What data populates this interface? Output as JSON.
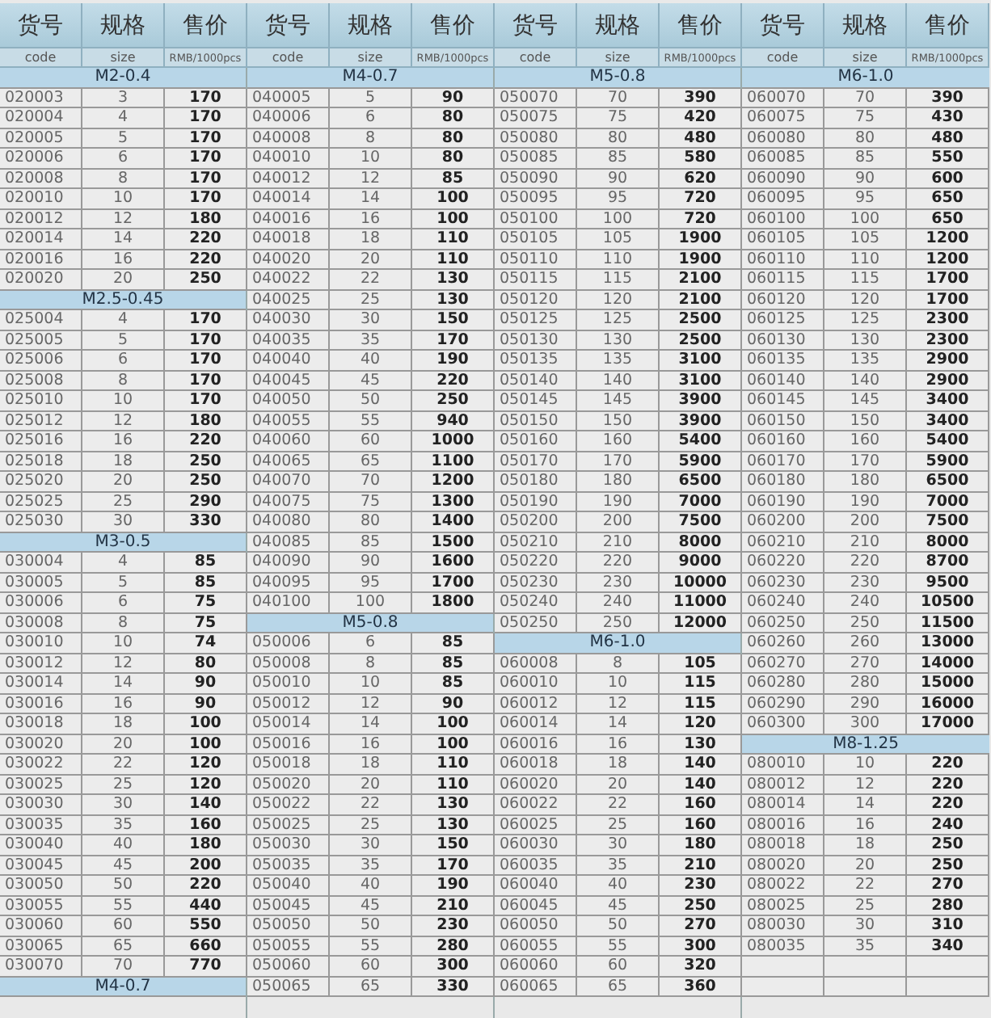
{
  "groups": [
    {
      "headers": [
        "货号",
        "规格",
        "售价"
      ],
      "subheaders": [
        "code",
        "size",
        "RMB/1000pcs"
      ],
      "entries": [
        {
          "kind": "section",
          "label": "M2-0.4"
        },
        {
          "kind": "item",
          "cells": [
            "020003",
            "3",
            "170"
          ]
        },
        {
          "kind": "item",
          "cells": [
            "020004",
            "4",
            "170"
          ]
        },
        {
          "kind": "item",
          "cells": [
            "020005",
            "5",
            "170"
          ]
        },
        {
          "kind": "item",
          "cells": [
            "020006",
            "6",
            "170"
          ]
        },
        {
          "kind": "item",
          "cells": [
            "020008",
            "8",
            "170"
          ]
        },
        {
          "kind": "item",
          "cells": [
            "020010",
            "10",
            "170"
          ]
        },
        {
          "kind": "item",
          "cells": [
            "020012",
            "12",
            "180"
          ]
        },
        {
          "kind": "item",
          "cells": [
            "020014",
            "14",
            "220"
          ]
        },
        {
          "kind": "item",
          "cells": [
            "020016",
            "16",
            "220"
          ]
        },
        {
          "kind": "item",
          "cells": [
            "020020",
            "20",
            "250"
          ]
        },
        {
          "kind": "section",
          "label": "M2.5-0.45"
        },
        {
          "kind": "item",
          "cells": [
            "025004",
            "4",
            "170"
          ]
        },
        {
          "kind": "item",
          "cells": [
            "025005",
            "5",
            "170"
          ]
        },
        {
          "kind": "item",
          "cells": [
            "025006",
            "6",
            "170"
          ]
        },
        {
          "kind": "item",
          "cells": [
            "025008",
            "8",
            "170"
          ]
        },
        {
          "kind": "item",
          "cells": [
            "025010",
            "10",
            "170"
          ]
        },
        {
          "kind": "item",
          "cells": [
            "025012",
            "12",
            "180"
          ]
        },
        {
          "kind": "item",
          "cells": [
            "025016",
            "16",
            "220"
          ]
        },
        {
          "kind": "item",
          "cells": [
            "025018",
            "18",
            "250"
          ]
        },
        {
          "kind": "item",
          "cells": [
            "025020",
            "20",
            "250"
          ]
        },
        {
          "kind": "item",
          "cells": [
            "025025",
            "25",
            "290"
          ]
        },
        {
          "kind": "item",
          "cells": [
            "025030",
            "30",
            "330"
          ]
        },
        {
          "kind": "section",
          "label": "M3-0.5"
        },
        {
          "kind": "item",
          "cells": [
            "030004",
            "4",
            "85"
          ]
        },
        {
          "kind": "item",
          "cells": [
            "030005",
            "5",
            "85"
          ]
        },
        {
          "kind": "item",
          "cells": [
            "030006",
            "6",
            "75"
          ]
        },
        {
          "kind": "item",
          "cells": [
            "030008",
            "8",
            "75"
          ]
        },
        {
          "kind": "item",
          "cells": [
            "030010",
            "10",
            "74"
          ]
        },
        {
          "kind": "item",
          "cells": [
            "030012",
            "12",
            "80"
          ]
        },
        {
          "kind": "item",
          "cells": [
            "030014",
            "14",
            "90"
          ]
        },
        {
          "kind": "item",
          "cells": [
            "030016",
            "16",
            "90"
          ]
        },
        {
          "kind": "item",
          "cells": [
            "030018",
            "18",
            "100"
          ]
        },
        {
          "kind": "item",
          "cells": [
            "030020",
            "20",
            "100"
          ]
        },
        {
          "kind": "item",
          "cells": [
            "030022",
            "22",
            "120"
          ]
        },
        {
          "kind": "item",
          "cells": [
            "030025",
            "25",
            "120"
          ]
        },
        {
          "kind": "item",
          "cells": [
            "030030",
            "30",
            "140"
          ]
        },
        {
          "kind": "item",
          "cells": [
            "030035",
            "35",
            "160"
          ]
        },
        {
          "kind": "item",
          "cells": [
            "030040",
            "40",
            "180"
          ]
        },
        {
          "kind": "item",
          "cells": [
            "030045",
            "45",
            "200"
          ]
        },
        {
          "kind": "item",
          "cells": [
            "030050",
            "50",
            "220"
          ]
        },
        {
          "kind": "item",
          "cells": [
            "030055",
            "55",
            "440"
          ]
        },
        {
          "kind": "item",
          "cells": [
            "030060",
            "60",
            "550"
          ]
        },
        {
          "kind": "item",
          "cells": [
            "030065",
            "65",
            "660"
          ]
        },
        {
          "kind": "item",
          "cells": [
            "030070",
            "70",
            "770"
          ]
        },
        {
          "kind": "section",
          "label": "M4-0.7"
        }
      ]
    },
    {
      "headers": [
        "货号",
        "规格",
        "售价"
      ],
      "subheaders": [
        "code",
        "size",
        "RMB/1000pcs"
      ],
      "entries": [
        {
          "kind": "section",
          "label": "M4-0.7"
        },
        {
          "kind": "item",
          "cells": [
            "040005",
            "5",
            "90"
          ]
        },
        {
          "kind": "item",
          "cells": [
            "040006",
            "6",
            "80"
          ]
        },
        {
          "kind": "item",
          "cells": [
            "040008",
            "8",
            "80"
          ]
        },
        {
          "kind": "item",
          "cells": [
            "040010",
            "10",
            "80"
          ]
        },
        {
          "kind": "item",
          "cells": [
            "040012",
            "12",
            "85"
          ]
        },
        {
          "kind": "item",
          "cells": [
            "040014",
            "14",
            "100"
          ]
        },
        {
          "kind": "item",
          "cells": [
            "040016",
            "16",
            "100"
          ]
        },
        {
          "kind": "item",
          "cells": [
            "040018",
            "18",
            "110"
          ]
        },
        {
          "kind": "item",
          "cells": [
            "040020",
            "20",
            "110"
          ]
        },
        {
          "kind": "item",
          "cells": [
            "040022",
            "22",
            "130"
          ]
        },
        {
          "kind": "item",
          "cells": [
            "040025",
            "25",
            "130"
          ]
        },
        {
          "kind": "item",
          "cells": [
            "040030",
            "30",
            "150"
          ]
        },
        {
          "kind": "item",
          "cells": [
            "040035",
            "35",
            "170"
          ]
        },
        {
          "kind": "item",
          "cells": [
            "040040",
            "40",
            "190"
          ]
        },
        {
          "kind": "item",
          "cells": [
            "040045",
            "45",
            "220"
          ]
        },
        {
          "kind": "item",
          "cells": [
            "040050",
            "50",
            "250"
          ]
        },
        {
          "kind": "item",
          "cells": [
            "040055",
            "55",
            "940"
          ]
        },
        {
          "kind": "item",
          "cells": [
            "040060",
            "60",
            "1000"
          ]
        },
        {
          "kind": "item",
          "cells": [
            "040065",
            "65",
            "1100"
          ]
        },
        {
          "kind": "item",
          "cells": [
            "040070",
            "70",
            "1200"
          ]
        },
        {
          "kind": "item",
          "cells": [
            "040075",
            "75",
            "1300"
          ]
        },
        {
          "kind": "item",
          "cells": [
            "040080",
            "80",
            "1400"
          ]
        },
        {
          "kind": "item",
          "cells": [
            "040085",
            "85",
            "1500"
          ]
        },
        {
          "kind": "item",
          "cells": [
            "040090",
            "90",
            "1600"
          ]
        },
        {
          "kind": "item",
          "cells": [
            "040095",
            "95",
            "1700"
          ]
        },
        {
          "kind": "item",
          "cells": [
            "040100",
            "100",
            "1800"
          ]
        },
        {
          "kind": "section",
          "label": "M5-0.8"
        },
        {
          "kind": "item",
          "cells": [
            "050006",
            "6",
            "85"
          ]
        },
        {
          "kind": "item",
          "cells": [
            "050008",
            "8",
            "85"
          ]
        },
        {
          "kind": "item",
          "cells": [
            "050010",
            "10",
            "85"
          ]
        },
        {
          "kind": "item",
          "cells": [
            "050012",
            "12",
            "90"
          ]
        },
        {
          "kind": "item",
          "cells": [
            "050014",
            "14",
            "100"
          ]
        },
        {
          "kind": "item",
          "cells": [
            "050016",
            "16",
            "100"
          ]
        },
        {
          "kind": "item",
          "cells": [
            "050018",
            "18",
            "110"
          ]
        },
        {
          "kind": "item",
          "cells": [
            "050020",
            "20",
            "110"
          ]
        },
        {
          "kind": "item",
          "cells": [
            "050022",
            "22",
            "130"
          ]
        },
        {
          "kind": "item",
          "cells": [
            "050025",
            "25",
            "130"
          ]
        },
        {
          "kind": "item",
          "cells": [
            "050030",
            "30",
            "150"
          ]
        },
        {
          "kind": "item",
          "cells": [
            "050035",
            "35",
            "170"
          ]
        },
        {
          "kind": "item",
          "cells": [
            "050040",
            "40",
            "190"
          ]
        },
        {
          "kind": "item",
          "cells": [
            "050045",
            "45",
            "210"
          ]
        },
        {
          "kind": "item",
          "cells": [
            "050050",
            "50",
            "230"
          ]
        },
        {
          "kind": "item",
          "cells": [
            "050055",
            "55",
            "280"
          ]
        },
        {
          "kind": "item",
          "cells": [
            "050060",
            "60",
            "300"
          ]
        },
        {
          "kind": "item",
          "cells": [
            "050065",
            "65",
            "330"
          ]
        }
      ]
    },
    {
      "headers": [
        "货号",
        "规格",
        "售价"
      ],
      "subheaders": [
        "code",
        "size",
        "RMB/1000pcs"
      ],
      "entries": [
        {
          "kind": "section",
          "label": "M5-0.8"
        },
        {
          "kind": "item",
          "cells": [
            "050070",
            "70",
            "390"
          ]
        },
        {
          "kind": "item",
          "cells": [
            "050075",
            "75",
            "420"
          ]
        },
        {
          "kind": "item",
          "cells": [
            "050080",
            "80",
            "480"
          ]
        },
        {
          "kind": "item",
          "cells": [
            "050085",
            "85",
            "580"
          ]
        },
        {
          "kind": "item",
          "cells": [
            "050090",
            "90",
            "620"
          ]
        },
        {
          "kind": "item",
          "cells": [
            "050095",
            "95",
            "720"
          ]
        },
        {
          "kind": "item",
          "cells": [
            "050100",
            "100",
            "720"
          ]
        },
        {
          "kind": "item",
          "cells": [
            "050105",
            "105",
            "1900"
          ]
        },
        {
          "kind": "item",
          "cells": [
            "050110",
            "110",
            "1900"
          ]
        },
        {
          "kind": "item",
          "cells": [
            "050115",
            "115",
            "2100"
          ]
        },
        {
          "kind": "item",
          "cells": [
            "050120",
            "120",
            "2100"
          ]
        },
        {
          "kind": "item",
          "cells": [
            "050125",
            "125",
            "2500"
          ]
        },
        {
          "kind": "item",
          "cells": [
            "050130",
            "130",
            "2500"
          ]
        },
        {
          "kind": "item",
          "cells": [
            "050135",
            "135",
            "3100"
          ]
        },
        {
          "kind": "item",
          "cells": [
            "050140",
            "140",
            "3100"
          ]
        },
        {
          "kind": "item",
          "cells": [
            "050145",
            "145",
            "3900"
          ]
        },
        {
          "kind": "item",
          "cells": [
            "050150",
            "150",
            "3900"
          ]
        },
        {
          "kind": "item",
          "cells": [
            "050160",
            "160",
            "5400"
          ]
        },
        {
          "kind": "item",
          "cells": [
            "050170",
            "170",
            "5900"
          ]
        },
        {
          "kind": "item",
          "cells": [
            "050180",
            "180",
            "6500"
          ]
        },
        {
          "kind": "item",
          "cells": [
            "050190",
            "190",
            "7000"
          ]
        },
        {
          "kind": "item",
          "cells": [
            "050200",
            "200",
            "7500"
          ]
        },
        {
          "kind": "item",
          "cells": [
            "050210",
            "210",
            "8000"
          ]
        },
        {
          "kind": "item",
          "cells": [
            "050220",
            "220",
            "9000"
          ]
        },
        {
          "kind": "item",
          "cells": [
            "050230",
            "230",
            "10000"
          ]
        },
        {
          "kind": "item",
          "cells": [
            "050240",
            "240",
            "11000"
          ]
        },
        {
          "kind": "item",
          "cells": [
            "050250",
            "250",
            "12000"
          ]
        },
        {
          "kind": "section",
          "label": "M6-1.0"
        },
        {
          "kind": "item",
          "cells": [
            "060008",
            "8",
            "105"
          ]
        },
        {
          "kind": "item",
          "cells": [
            "060010",
            "10",
            "115"
          ]
        },
        {
          "kind": "item",
          "cells": [
            "060012",
            "12",
            "115"
          ]
        },
        {
          "kind": "item",
          "cells": [
            "060014",
            "14",
            "120"
          ]
        },
        {
          "kind": "item",
          "cells": [
            "060016",
            "16",
            "130"
          ]
        },
        {
          "kind": "item",
          "cells": [
            "060018",
            "18",
            "140"
          ]
        },
        {
          "kind": "item",
          "cells": [
            "060020",
            "20",
            "140"
          ]
        },
        {
          "kind": "item",
          "cells": [
            "060022",
            "22",
            "160"
          ]
        },
        {
          "kind": "item",
          "cells": [
            "060025",
            "25",
            "160"
          ]
        },
        {
          "kind": "item",
          "cells": [
            "060030",
            "30",
            "180"
          ]
        },
        {
          "kind": "item",
          "cells": [
            "060035",
            "35",
            "210"
          ]
        },
        {
          "kind": "item",
          "cells": [
            "060040",
            "40",
            "230"
          ]
        },
        {
          "kind": "item",
          "cells": [
            "060045",
            "45",
            "250"
          ]
        },
        {
          "kind": "item",
          "cells": [
            "060050",
            "50",
            "270"
          ]
        },
        {
          "kind": "item",
          "cells": [
            "060055",
            "55",
            "300"
          ]
        },
        {
          "kind": "item",
          "cells": [
            "060060",
            "60",
            "320"
          ]
        },
        {
          "kind": "item",
          "cells": [
            "060065",
            "65",
            "360"
          ]
        }
      ]
    },
    {
      "headers": [
        "货号",
        "规格",
        "售价"
      ],
      "subheaders": [
        "code",
        "size",
        "RMB/1000pcs"
      ],
      "entries": [
        {
          "kind": "section",
          "label": "M6-1.0"
        },
        {
          "kind": "item",
          "cells": [
            "060070",
            "70",
            "390"
          ]
        },
        {
          "kind": "item",
          "cells": [
            "060075",
            "75",
            "430"
          ]
        },
        {
          "kind": "item",
          "cells": [
            "060080",
            "80",
            "480"
          ]
        },
        {
          "kind": "item",
          "cells": [
            "060085",
            "85",
            "550"
          ]
        },
        {
          "kind": "item",
          "cells": [
            "060090",
            "90",
            "600"
          ]
        },
        {
          "kind": "item",
          "cells": [
            "060095",
            "95",
            "650"
          ]
        },
        {
          "kind": "item",
          "cells": [
            "060100",
            "100",
            "650"
          ]
        },
        {
          "kind": "item",
          "cells": [
            "060105",
            "105",
            "1200"
          ]
        },
        {
          "kind": "item",
          "cells": [
            "060110",
            "110",
            "1200"
          ]
        },
        {
          "kind": "item",
          "cells": [
            "060115",
            "115",
            "1700"
          ]
        },
        {
          "kind": "item",
          "cells": [
            "060120",
            "120",
            "1700"
          ]
        },
        {
          "kind": "item",
          "cells": [
            "060125",
            "125",
            "2300"
          ]
        },
        {
          "kind": "item",
          "cells": [
            "060130",
            "130",
            "2300"
          ]
        },
        {
          "kind": "item",
          "cells": [
            "060135",
            "135",
            "2900"
          ]
        },
        {
          "kind": "item",
          "cells": [
            "060140",
            "140",
            "2900"
          ]
        },
        {
          "kind": "item",
          "cells": [
            "060145",
            "145",
            "3400"
          ]
        },
        {
          "kind": "item",
          "cells": [
            "060150",
            "150",
            "3400"
          ]
        },
        {
          "kind": "item",
          "cells": [
            "060160",
            "160",
            "5400"
          ]
        },
        {
          "kind": "item",
          "cells": [
            "060170",
            "170",
            "5900"
          ]
        },
        {
          "kind": "item",
          "cells": [
            "060180",
            "180",
            "6500"
          ]
        },
        {
          "kind": "item",
          "cells": [
            "060190",
            "190",
            "7000"
          ]
        },
        {
          "kind": "item",
          "cells": [
            "060200",
            "200",
            "7500"
          ]
        },
        {
          "kind": "item",
          "cells": [
            "060210",
            "210",
            "8000"
          ]
        },
        {
          "kind": "item",
          "cells": [
            "060220",
            "220",
            "8700"
          ]
        },
        {
          "kind": "item",
          "cells": [
            "060230",
            "230",
            "9500"
          ]
        },
        {
          "kind": "item",
          "cells": [
            "060240",
            "240",
            "10500"
          ]
        },
        {
          "kind": "item",
          "cells": [
            "060250",
            "250",
            "11500"
          ]
        },
        {
          "kind": "item",
          "cells": [
            "060260",
            "260",
            "13000"
          ]
        },
        {
          "kind": "item",
          "cells": [
            "060270",
            "270",
            "14000"
          ]
        },
        {
          "kind": "item",
          "cells": [
            "060280",
            "280",
            "15000"
          ]
        },
        {
          "kind": "item",
          "cells": [
            "060290",
            "290",
            "16000"
          ]
        },
        {
          "kind": "item",
          "cells": [
            "060300",
            "300",
            "17000"
          ]
        },
        {
          "kind": "section",
          "label": "M8-1.25"
        },
        {
          "kind": "item",
          "cells": [
            "080010",
            "10",
            "220"
          ]
        },
        {
          "kind": "item",
          "cells": [
            "080012",
            "12",
            "220"
          ]
        },
        {
          "kind": "item",
          "cells": [
            "080014",
            "14",
            "220"
          ]
        },
        {
          "kind": "item",
          "cells": [
            "080016",
            "16",
            "240"
          ]
        },
        {
          "kind": "item",
          "cells": [
            "080018",
            "18",
            "250"
          ]
        },
        {
          "kind": "item",
          "cells": [
            "080020",
            "20",
            "250"
          ]
        },
        {
          "kind": "item",
          "cells": [
            "080022",
            "22",
            "270"
          ]
        },
        {
          "kind": "item",
          "cells": [
            "080025",
            "25",
            "280"
          ]
        },
        {
          "kind": "item",
          "cells": [
            "080030",
            "30",
            "310"
          ]
        },
        {
          "kind": "item",
          "cells": [
            "080035",
            "35",
            "340"
          ]
        },
        {
          "kind": "empty"
        },
        {
          "kind": "empty"
        }
      ]
    }
  ]
}
